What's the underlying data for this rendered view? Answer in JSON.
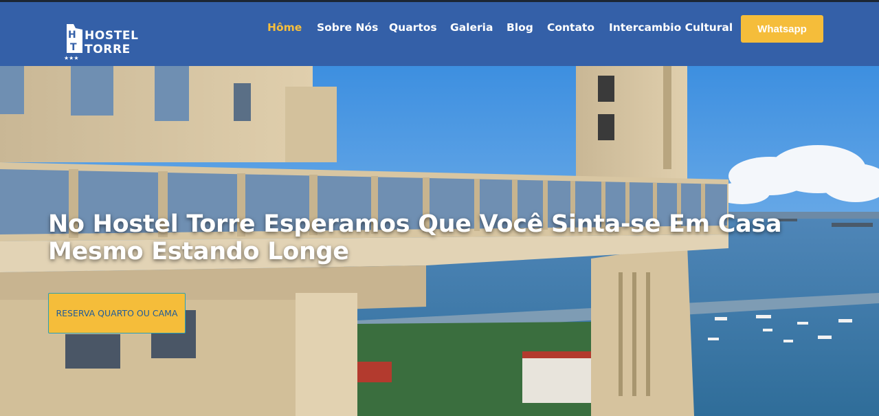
{
  "header": {
    "logo": {
      "brand_line1": "HOSTEL",
      "brand_line2": "TORRE",
      "monogram": "HT",
      "stars": "★★★"
    },
    "nav": [
      {
        "label": "Hôme",
        "active": true
      },
      {
        "label": "Sobre Nós",
        "active": false
      },
      {
        "label": "Quartos",
        "active": false
      },
      {
        "label": "Galeria",
        "active": false
      },
      {
        "label": "Blog",
        "active": false
      },
      {
        "label": "Contato",
        "active": false
      },
      {
        "label": "Intercambio Cultural",
        "active": false
      }
    ],
    "whatsapp_label": "Whatsapp"
  },
  "hero": {
    "title_line1": "No Hostel Torre Esperamos Que Você Sinta-se Em Casa",
    "title_line2": "Mesmo Estando Longe",
    "cta_label": "RESERVA QUARTO OU CAMA"
  },
  "colors": {
    "header_bg": "#3460a8",
    "accent": "#f5bd3a",
    "nav_active": "#f7bf3c",
    "cta_text": "#1f5b99"
  }
}
